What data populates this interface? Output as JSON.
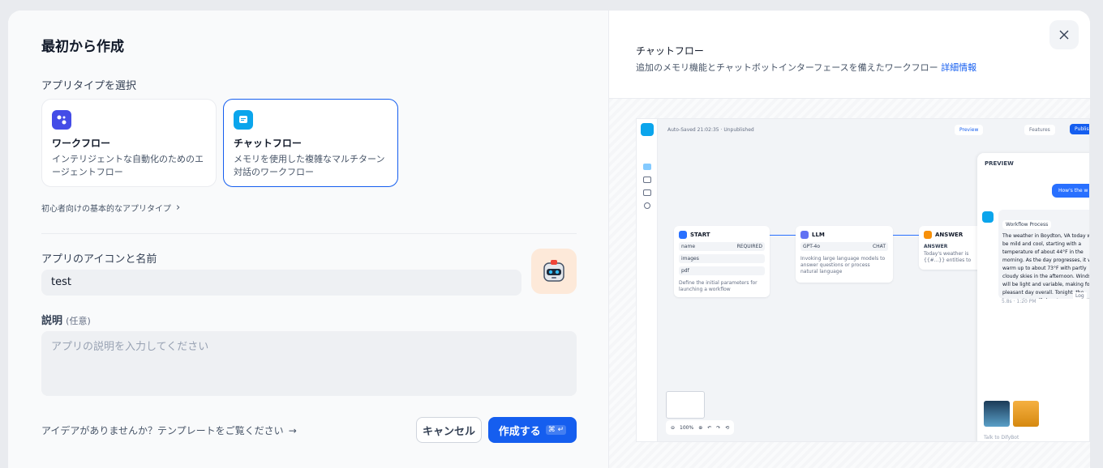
{
  "dialog": {
    "title": "最初から作成",
    "app_type_label": "アプリタイプを選択",
    "app_types": [
      {
        "name": "ワークフロー",
        "desc": "インテリジェントな自動化のためのエージェントフロー",
        "icon": "workflow-icon",
        "color": "#444ce7"
      },
      {
        "name": "チャットフロー",
        "desc": "メモリを使用した複雑なマルチターン対話のワークフロー",
        "icon": "chatflow-icon",
        "color": "#0ba5ec",
        "selected": true
      }
    ],
    "beginner_link": "初心者向けの基本的なアプリタイプ",
    "name_label": "アプリのアイコンと名前",
    "name_value": "test",
    "desc_label": "説明",
    "desc_optional": "(任意)",
    "desc_placeholder": "アプリの説明を入力してください",
    "idea_link": "アイデアがありませんか？テンプレートをご覧ください",
    "cancel_label": "キャンセル",
    "create_label": "作成する",
    "create_shortcut": "⌘ ↵",
    "accent": "#155eef"
  },
  "preview": {
    "title": "チャットフロー",
    "desc": "追加のメモリ機能とチャットボットインターフェースを備えたワークフロー",
    "more_link": "詳細情報",
    "shot": {
      "autosave": "Auto-Saved 21:02:35 · Unpublished",
      "preview_btn": "Preview",
      "features_btn": "Features",
      "publish_btn": "Publish",
      "nodes": {
        "start_title": "START",
        "start_vars": [
          "name",
          "images",
          "pdf"
        ],
        "start_required": "REQUIRED",
        "start_desc": "Define the initial parameters for launching a workflow",
        "llm_title": "LLM",
        "llm_model": "GPT-4o",
        "llm_mode": "CHAT",
        "llm_desc": "Invoking large language models to answer questions or process natural language",
        "answer_title": "ANSWER",
        "answer_label": "ANSWER",
        "answer_text": "Today's weather is {{#...}} entities to extract."
      },
      "panel": {
        "title": "PREVIEW",
        "user_msg": "How's the w",
        "process": "Workflow Process",
        "reply": "The weather in Boydton, VA today will be mild and cool, starting with a temperature of about 44°F in the morning. As the day progresses, it will warm up to about 73°F with partly cloudy skies in the afternoon. Winds will be light and variable, making for a pleasant day overall. Tonight, the temperature will drop to around 50°F with a few clouds.",
        "meta": "5.8s · 1:20 PM",
        "log": "Log",
        "input_placeholder": "Talk to DifyBot"
      },
      "zoom": "100%"
    }
  }
}
